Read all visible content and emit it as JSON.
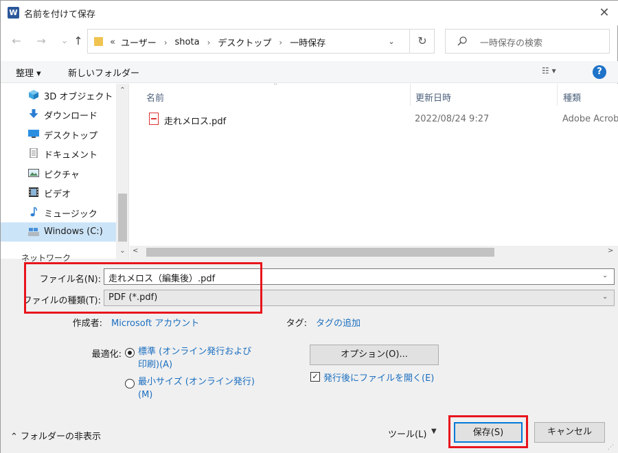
{
  "window": {
    "title": "名前を付けて保存",
    "app_icon": "W",
    "close_glyph": "✕"
  },
  "nav_buttons": {
    "back": "←",
    "forward": "→",
    "history": "⌄",
    "up": "↑"
  },
  "address": {
    "more": "«",
    "crumbs": [
      "ユーザー",
      "shota",
      "デスクトップ",
      "一時保存"
    ],
    "sep": "›",
    "dropdown": "⌄",
    "refresh": "↻"
  },
  "search": {
    "placeholder": "一時保存の検索"
  },
  "toolbar": {
    "organize": "整理 ▾",
    "new_folder": "新しいフォルダー",
    "view": "☷ ▾",
    "help": "?"
  },
  "nav_pane": {
    "items": [
      {
        "label": "3D オブジェクト",
        "icon": "cube-icon",
        "color": "#3fa7e0"
      },
      {
        "label": "ダウンロード",
        "icon": "download-arrow-icon",
        "color": "#2a7fd4"
      },
      {
        "label": "デスクトップ",
        "icon": "desktop-icon",
        "color": "#2a8fe0"
      },
      {
        "label": "ドキュメント",
        "icon": "document-icon",
        "color": "#555555"
      },
      {
        "label": "ピクチャ",
        "icon": "picture-icon",
        "color": "#4a8c5a"
      },
      {
        "label": "ビデオ",
        "icon": "film-icon",
        "color": "#333333"
      },
      {
        "label": "ミュージック",
        "icon": "music-note-icon",
        "color": "#2a7fd4"
      },
      {
        "label": "Windows (C:)",
        "icon": "drive-icon",
        "color": "#4a90d9"
      }
    ],
    "partial_item": "ネットワーク",
    "scroll_up": "⌃",
    "scroll_down": "⌄"
  },
  "file_pane": {
    "sort_caret": "⌃",
    "columns": [
      "名前",
      "更新日時",
      "種類"
    ],
    "rows": [
      {
        "name": "走れメロス.pdf",
        "modified": "2022/08/24 9:27",
        "type": "Adobe Acrob"
      }
    ],
    "scroll_left": "<",
    "scroll_right": ">"
  },
  "form": {
    "filename_label": "ファイル名(N):",
    "filename_value": "走れメロス（編集後）.pdf",
    "filetype_label": "ファイルの種類(T):",
    "filetype_value": "PDF (*.pdf)",
    "dropdown_glyph": "⌄",
    "author_label": "作成者:",
    "author_value": "Microsoft アカウント",
    "tags_label": "タグ:",
    "tags_value": "タグの追加",
    "optimize_label": "最適化:",
    "optimize_options": [
      {
        "label": "標準 (オンライン発行および印刷)(A)",
        "selected": true
      },
      {
        "label": "最小サイズ (オンライン発行)(M)",
        "selected": false
      }
    ],
    "options_button": "オプション(O)...",
    "open_after_label": "発行後にファイルを開く(E)",
    "open_after_checked": "✓"
  },
  "footer": {
    "hide_folders": "⌃ フォルダーの非表示",
    "tools": "ツール(L)",
    "tools_caret": "▼",
    "save": "保存(S)",
    "cancel": "キャンセル",
    "grip": "⋰"
  },
  "colors": {
    "highlight_box": "#e8141c",
    "link": "#1a6ebf",
    "selected_nav": "#cce4f7"
  }
}
